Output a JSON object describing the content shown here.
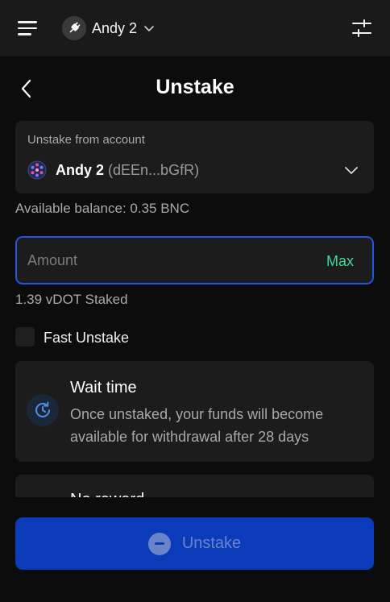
{
  "header": {
    "account_name": "Andy 2",
    "menu_icon": "hamburger-menu-icon",
    "settings_icon": "sliders-icon",
    "avatar_icon": "plug-icon"
  },
  "page": {
    "title": "Unstake"
  },
  "account_card": {
    "label": "Unstake from account",
    "selected_name": "Andy 2",
    "selected_address": "(dEEn...bGfR)"
  },
  "balance": {
    "text": "Available balance: 0.35 BNC"
  },
  "amount": {
    "placeholder": "Amount",
    "value": "",
    "max_label": "Max"
  },
  "staked": {
    "text": "1.39 vDOT Staked"
  },
  "fast_unstake": {
    "label": "Fast Unstake",
    "checked": false
  },
  "wait_card": {
    "title": "Wait time",
    "description": "Once unstaked, your funds will become available for withdrawal after 28 days"
  },
  "second_card": {
    "title": "No reward"
  },
  "actions": {
    "unstake_label": "Unstake"
  },
  "colors": {
    "accent_blue": "#2454e0",
    "button_blue": "#0b3bb8",
    "max_green": "#3fd89a"
  }
}
